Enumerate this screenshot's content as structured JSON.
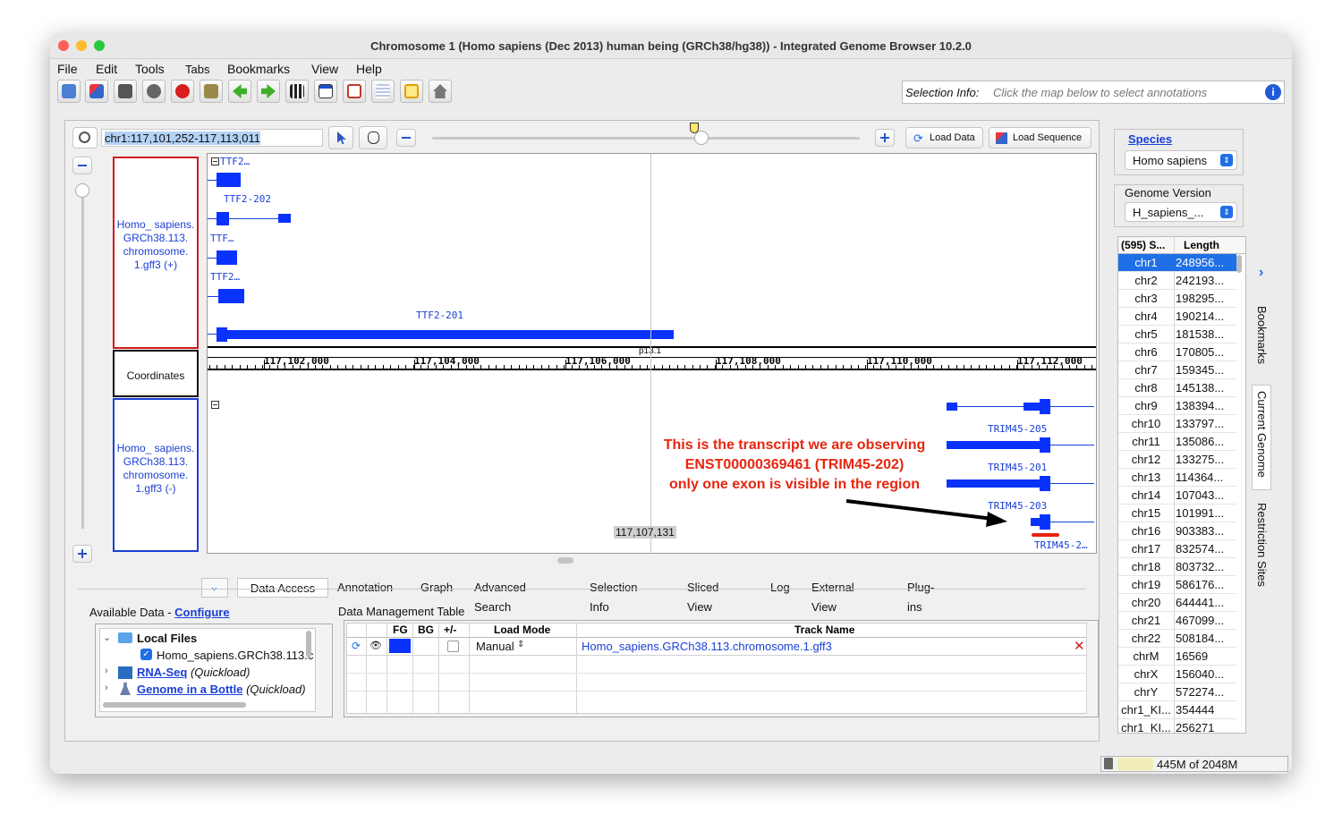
{
  "window": {
    "title": "Chromosome 1  (Homo sapiens (Dec 2013) human being (GRCh38/hg38)) - Integrated Genome Browser 10.2.0"
  },
  "menu": [
    "File",
    "Edit",
    "Tools",
    "Tabs",
    "Bookmarks",
    "View",
    "Help"
  ],
  "selection_info": {
    "label": "Selection Info:",
    "placeholder": "Click the map below to select annotations"
  },
  "search": {
    "value": "chr1:117,101,252-117,113,011"
  },
  "buttons": {
    "load_data": "Load Data",
    "load_sequence": "Load Sequence"
  },
  "zoom_level": 0.63,
  "tracks": {
    "plus": "Homo_ sapiens. GRCh38.113. chromosome. 1.gff3 (+)",
    "coords": "Coordinates",
    "minus": "Homo_ sapiens. GRCh38.113. chromosome. 1.gff3 (-)"
  },
  "plus_labels": [
    "TTF2…",
    "TTF2-202",
    "TTF…",
    "TTF2…",
    "TTF2-201"
  ],
  "minus_labels": [
    "TRIM45-205",
    "TRIM45-201",
    "TRIM45-203",
    "TRIM45-2…"
  ],
  "coordinates": {
    "ticks": [
      "117,102,000",
      "117,104,000",
      "117,106,000",
      "117,108,000",
      "117,110,000",
      "117,112,000"
    ],
    "band": "p13.1",
    "cursor": "117,107,131"
  },
  "annotation": {
    "lines": [
      "This is the transcript we are observing",
      "ENST00000369461 (TRIM45-202)",
      "only one exon is visible in the region"
    ],
    "color": "#e8250e"
  },
  "bottom_tabs": [
    "Data Access",
    "Annotation",
    "Graph",
    "Advanced Search",
    "Selection Info",
    "Sliced View",
    "Log",
    "External View",
    "Plug-ins"
  ],
  "available_data": {
    "title": "Available Data -",
    "configure": "Configure",
    "local_files": "Local Files",
    "local_file": "Homo_sapiens.GRCh38.113.c",
    "rnaseq": "RNA-Seq",
    "rnaseq_note": "(Quickload)",
    "gib": "Genome in a Bottle",
    "gib_note": "(Quickload)"
  },
  "dmt": {
    "title": "Data Management Table",
    "headers": [
      "FG",
      "BG",
      "+/-",
      "Load Mode",
      "Track Name"
    ],
    "row": {
      "load_mode": "Manual",
      "track_name": "Homo_sapiens.GRCh38.113.chromosome.1.gff3"
    }
  },
  "species": {
    "label": "Species",
    "value": "Homo sapiens"
  },
  "genome_version": {
    "label": "Genome Version",
    "value": "H_sapiens_..."
  },
  "chr_table": {
    "headers": [
      "(595) S...",
      "Length"
    ],
    "rows": [
      [
        "chr1",
        "248956..."
      ],
      [
        "chr2",
        "242193..."
      ],
      [
        "chr3",
        "198295..."
      ],
      [
        "chr4",
        "190214..."
      ],
      [
        "chr5",
        "181538..."
      ],
      [
        "chr6",
        "170805..."
      ],
      [
        "chr7",
        "159345..."
      ],
      [
        "chr8",
        "145138..."
      ],
      [
        "chr9",
        "138394..."
      ],
      [
        "chr10",
        "133797..."
      ],
      [
        "chr11",
        "135086..."
      ],
      [
        "chr12",
        "133275..."
      ],
      [
        "chr13",
        "114364..."
      ],
      [
        "chr14",
        "107043..."
      ],
      [
        "chr15",
        "101991..."
      ],
      [
        "chr16",
        "903383..."
      ],
      [
        "chr17",
        "832574..."
      ],
      [
        "chr18",
        "803732..."
      ],
      [
        "chr19",
        "586176..."
      ],
      [
        "chr20",
        "644441..."
      ],
      [
        "chr21",
        "467099..."
      ],
      [
        "chr22",
        "508184..."
      ],
      [
        "chrM",
        "16569"
      ],
      [
        "chrX",
        "156040..."
      ],
      [
        "chrY",
        "572274..."
      ],
      [
        "chr1_KI...",
        "354444"
      ],
      [
        "chr1_KI...",
        "256271"
      ]
    ]
  },
  "side_tabs": [
    "Bookmarks",
    "Current Genome",
    "Restriction Sites"
  ],
  "memory": "445M of 2048M",
  "colors": {
    "feature": "#0a32ff",
    "accent": "#1a5ee6",
    "selected_row": "#1f6fe6"
  }
}
